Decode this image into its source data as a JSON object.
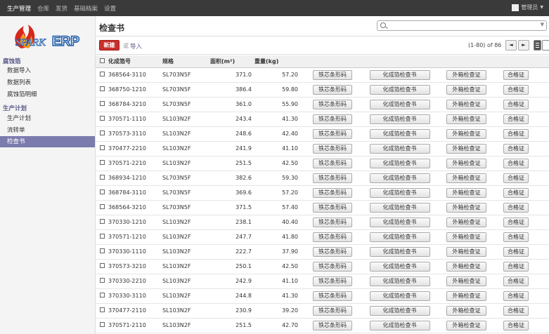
{
  "topbar": {
    "menu": [
      "生产管理",
      "仓库",
      "发货",
      "基础档案",
      "设置"
    ],
    "user_name": "管理员"
  },
  "logo": {
    "text_main": "SPARK",
    "text_accent": "ERP"
  },
  "sidebar": {
    "sections": [
      {
        "label": "腐蚀箔",
        "items": [
          "数据导入",
          "数据列表",
          "腐蚀箔明细"
        ]
      },
      {
        "label": "生产计划",
        "items": [
          "生产计划",
          "流转单",
          "检查书"
        ]
      }
    ],
    "active_item": "检查书"
  },
  "page": {
    "title": "检查书",
    "new_label": "新建",
    "or_label": "或",
    "import_label": "导入",
    "pager": "(1-80) of 86",
    "prev_icon": "◄",
    "next_icon": "►",
    "search_placeholder": ""
  },
  "table": {
    "headers": [
      "化成箔号",
      "规格",
      "面积(m²)",
      "重量(kg)"
    ],
    "action_labels": [
      "铁芯条形码",
      "化成箔检查书",
      "外箱检查证",
      "合格证"
    ],
    "rows": [
      [
        "368564-3110",
        "SL703N5F",
        "371.0",
        "57.20"
      ],
      [
        "368750-1210",
        "SL703N5F",
        "386.4",
        "59.80"
      ],
      [
        "368784-3210",
        "SL703N5F",
        "361.0",
        "55.90"
      ],
      [
        "370571-1110",
        "SL103N2F",
        "243.4",
        "41.30"
      ],
      [
        "370573-3110",
        "SL103N2F",
        "248.6",
        "42.40"
      ],
      [
        "370477-2210",
        "SL103N2F",
        "241.9",
        "41.10"
      ],
      [
        "370571-2210",
        "SL103N2F",
        "251.5",
        "42.50"
      ],
      [
        "368934-1210",
        "SL703N5F",
        "382.6",
        "59.30"
      ],
      [
        "368784-3110",
        "SL703N5F",
        "369.6",
        "57.20"
      ],
      [
        "368564-3210",
        "SL703N5F",
        "371.5",
        "57.40"
      ],
      [
        "370330-1210",
        "SL103N2F",
        "238.1",
        "40.40"
      ],
      [
        "370571-1210",
        "SL103N2F",
        "247.7",
        "41.80"
      ],
      [
        "370330-1110",
        "SL103N2F",
        "222.7",
        "37.90"
      ],
      [
        "370573-3210",
        "SL103N2F",
        "250.1",
        "42.50"
      ],
      [
        "370330-2210",
        "SL103N2F",
        "242.9",
        "41.10"
      ],
      [
        "370330-3110",
        "SL103N2F",
        "244.8",
        "41.30"
      ],
      [
        "370477-2110",
        "SL103N2F",
        "230.9",
        "39.20"
      ],
      [
        "370571-2110",
        "SL103N2F",
        "251.5",
        "42.70"
      ]
    ]
  },
  "colors": {
    "topbar": "#3a3a3a",
    "accent": "#7c7bad",
    "primary_button": "#c9302c",
    "logo_red": "#d9261c",
    "logo_blue": "#1f5ea8"
  }
}
